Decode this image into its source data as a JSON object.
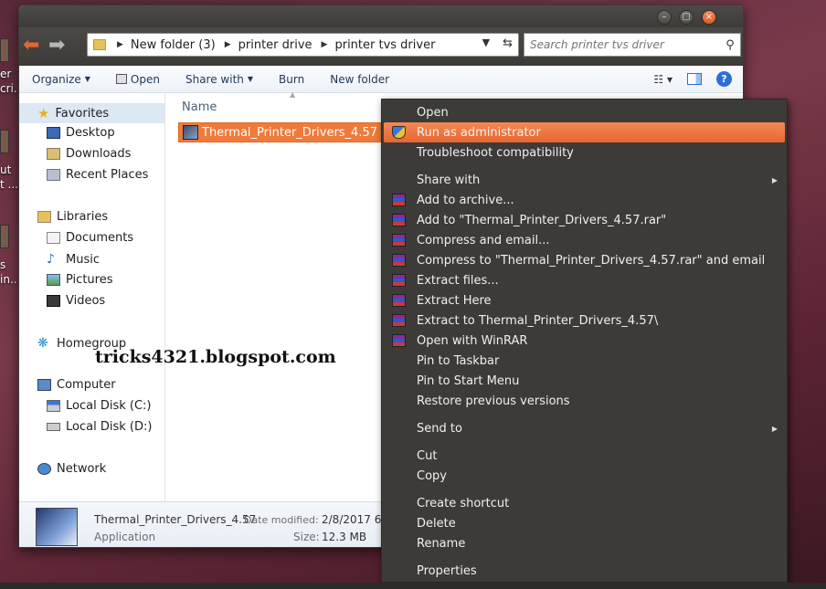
{
  "desktop": {
    "icon_labels": [
      "er",
      "cri...",
      "ut",
      "t ...",
      "s",
      "in..."
    ]
  },
  "window": {
    "controls": {
      "minimize": "–",
      "maximize": "▢",
      "close": "×"
    },
    "breadcrumbs": [
      "New folder (3)",
      "printer drive",
      "printer tvs driver"
    ],
    "search_placeholder": "Search printer tvs driver",
    "toolbar": {
      "organize": "Organize",
      "open": "Open",
      "share_with": "Share with",
      "burn": "Burn",
      "new_folder": "New folder"
    },
    "nav": {
      "favorites": "Favorites",
      "desktop": "Desktop",
      "downloads": "Downloads",
      "recent_places": "Recent Places",
      "libraries": "Libraries",
      "documents": "Documents",
      "music": "Music",
      "pictures": "Pictures",
      "videos": "Videos",
      "homegroup": "Homegroup",
      "computer": "Computer",
      "local_disk_c": "Local Disk (C:)",
      "local_disk_d": "Local Disk (D:)",
      "network": "Network"
    },
    "column_name": "Name",
    "file": {
      "name": "Thermal_Printer_Drivers_4.57"
    },
    "details": {
      "name": "Thermal_Printer_Drivers_4.57",
      "type": "Application",
      "date_label": "Date modified:",
      "date_value": "2/8/2017 6:",
      "size_label": "Size:",
      "size_value": "12.3 MB"
    }
  },
  "watermark": "tricks4321.blogspot.com",
  "context_menu": {
    "items": [
      "Open",
      "Run as administrator",
      "Troubleshoot compatibility",
      "Share with",
      "Add to archive...",
      "Add to \"Thermal_Printer_Drivers_4.57.rar\"",
      "Compress and email...",
      "Compress to \"Thermal_Printer_Drivers_4.57.rar\" and email",
      "Extract files...",
      "Extract Here",
      "Extract to Thermal_Printer_Drivers_4.57\\",
      "Open with WinRAR",
      "Pin to Taskbar",
      "Pin to Start Menu",
      "Restore previous versions",
      "Send to",
      "Cut",
      "Copy",
      "Create shortcut",
      "Delete",
      "Rename",
      "Properties"
    ]
  },
  "colors": {
    "highlight": "#e8662f",
    "menu_bg": "#3c3b37",
    "selection": "#ef7a3a"
  }
}
